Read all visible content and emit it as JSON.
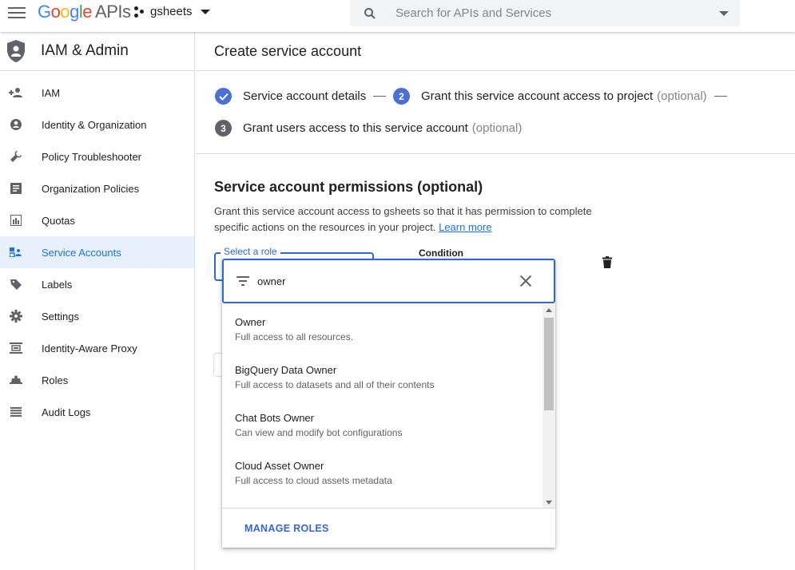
{
  "header": {
    "logo_google": "Google",
    "logo_apis": "APIs",
    "project": "gsheets",
    "search_placeholder": "Search for APIs and Services"
  },
  "sidebar": {
    "title": "IAM & Admin",
    "items": [
      {
        "label": "IAM",
        "icon": "person-add-icon"
      },
      {
        "label": "Identity & Organization",
        "icon": "account-circle-icon"
      },
      {
        "label": "Policy Troubleshooter",
        "icon": "wrench-icon"
      },
      {
        "label": "Organization Policies",
        "icon": "article-icon"
      },
      {
        "label": "Quotas",
        "icon": "quota-icon"
      },
      {
        "label": "Service Accounts",
        "icon": "service-account-icon",
        "active": true
      },
      {
        "label": "Labels",
        "icon": "label-icon"
      },
      {
        "label": "Settings",
        "icon": "gear-icon"
      },
      {
        "label": "Identity-Aware Proxy",
        "icon": "proxy-icon"
      },
      {
        "label": "Roles",
        "icon": "roles-icon"
      },
      {
        "label": "Audit Logs",
        "icon": "list-icon"
      }
    ]
  },
  "main": {
    "title": "Create service account",
    "steps": [
      {
        "num": "",
        "label": "Service account details",
        "optional": "",
        "state": "done"
      },
      {
        "num": "2",
        "label": "Grant this service account access to project",
        "optional": "(optional)",
        "state": "active"
      },
      {
        "num": "3",
        "label": "Grant users access to this service account",
        "optional": "(optional)",
        "state": "pending"
      }
    ],
    "permissions": {
      "heading": "Service account permissions (optional)",
      "description": "Grant this service account access to gsheets so that it has permission to complete specific actions on the resources in your project.",
      "learn_more": "Learn more"
    },
    "role_field_label": "Select a role",
    "condition_label": "Condition"
  },
  "dropdown": {
    "filter_value": "owner",
    "options": [
      {
        "name": "Owner",
        "desc": "Full access to all resources."
      },
      {
        "name": "BigQuery Data Owner",
        "desc": "Full access to datasets and all of their contents"
      },
      {
        "name": "Chat Bots Owner",
        "desc": "Can view and modify bot configurations"
      },
      {
        "name": "Cloud Asset Owner",
        "desc": "Full access to cloud assets metadata"
      }
    ],
    "manage_roles": "MANAGE ROLES"
  },
  "colors": {
    "accent": "#3367d6",
    "step_done": "#4a6fd8",
    "step_pending": "#5f6368",
    "active_bg": "#e8f0fe"
  }
}
